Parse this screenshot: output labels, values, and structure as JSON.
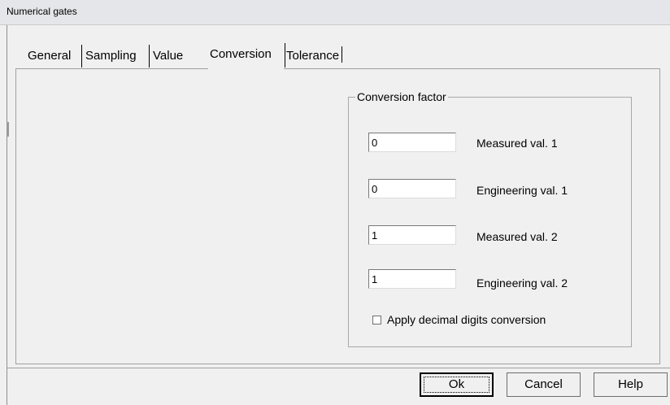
{
  "window": {
    "title": "Numerical gates"
  },
  "tabs": [
    {
      "label": "General",
      "active": false
    },
    {
      "label": "Sampling",
      "active": false
    },
    {
      "label": "Value",
      "active": false
    },
    {
      "label": "Conversion",
      "active": true
    },
    {
      "label": "Tolerance",
      "active": false
    }
  ],
  "conversion": {
    "group_title": "Conversion factor",
    "fields": [
      {
        "label": "Measured val. 1",
        "value": "0"
      },
      {
        "label": "Engineering val. 1",
        "value": "0"
      },
      {
        "label": "Measured val. 2",
        "value": "1"
      },
      {
        "label": "Engineering val. 2",
        "value": "1"
      }
    ],
    "decimal_checkbox": {
      "label": "Apply decimal digits conversion",
      "checked": false
    }
  },
  "buttons": {
    "ok": "Ok",
    "cancel": "Cancel",
    "help": "Help"
  }
}
